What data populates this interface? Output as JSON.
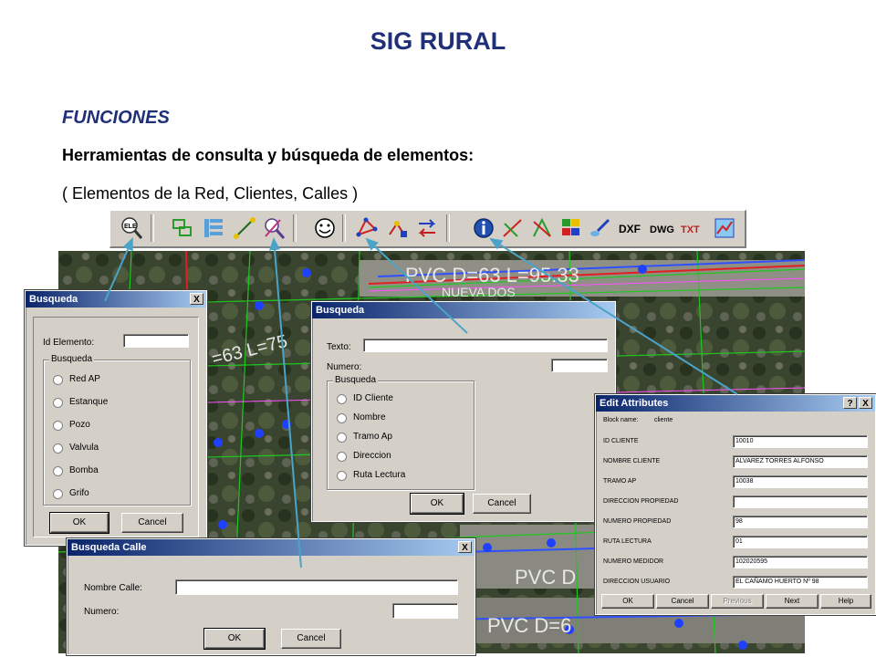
{
  "slide": {
    "title": "SIG RURAL",
    "section": "FUNCIONES",
    "heading": "Herramientas de consulta y búsqueda de elementos:",
    "subheading": "( Elementos de la Red, Clientes, Calles )"
  },
  "toolbar": {
    "items": [
      "ELE",
      "DXF",
      "DWG",
      "TXT"
    ]
  },
  "map": {
    "labels": [
      "PVC D=63 L=95.33",
      "NUEVA DOS",
      "=63 L=75",
      "PVC D",
      "PVC D=6"
    ]
  },
  "dialog_busqueda": {
    "title": "Busqueda",
    "id_label": "Id Elemento:",
    "id_value": "",
    "group": "Busqueda",
    "options": [
      "Red AP",
      "Estanque",
      "Pozo",
      "Valvula",
      "Bomba",
      "Grifo"
    ],
    "ok": "OK",
    "cancel": "Cancel",
    "close": "X"
  },
  "dialog_busqueda_clientes": {
    "title": "Busqueda",
    "texto_label": "Texto:",
    "numero_label": "Numero:",
    "group": "Busqueda",
    "options": [
      "ID Cliente",
      "Nombre",
      "Tramo Ap",
      "Direccion",
      "Ruta Lectura"
    ],
    "ok": "OK",
    "cancel": "Cancel"
  },
  "dialog_calle": {
    "title": "Busqueda Calle",
    "nombre_label": "Nombre Calle:",
    "numero_label": "Numero:",
    "ok": "OK",
    "cancel": "Cancel",
    "close": "X"
  },
  "dialog_attributes": {
    "title": "Edit Attributes",
    "help": "?",
    "close": "X",
    "block_label": "Block name:",
    "block_value": "cliente",
    "fields": [
      {
        "label": "ID CLIENTE",
        "value": "10010"
      },
      {
        "label": "NOMBRE CLIENTE",
        "value": "ALVAREZ TORRES ALFONSO"
      },
      {
        "label": "TRAMO AP",
        "value": "10038"
      },
      {
        "label": "DIRECCION PROPIEDAD",
        "value": ""
      },
      {
        "label": "NUMERO PROPIEDAD",
        "value": "98"
      },
      {
        "label": "RUTA LECTURA",
        "value": "01"
      },
      {
        "label": "NUMERO MEDIDOR",
        "value": "102020595"
      },
      {
        "label": "DIRECCION USUARIO",
        "value": "EL CAÑAMO HUERTO Nº 98"
      }
    ],
    "buttons": {
      "ok": "OK",
      "cancel": "Cancel",
      "previous": "Previous",
      "next": "Next",
      "help": "Help"
    }
  },
  "colors": {
    "title": "#1f2f78",
    "arrow": "#4aa3c8",
    "titlebar": "#0a246a"
  }
}
